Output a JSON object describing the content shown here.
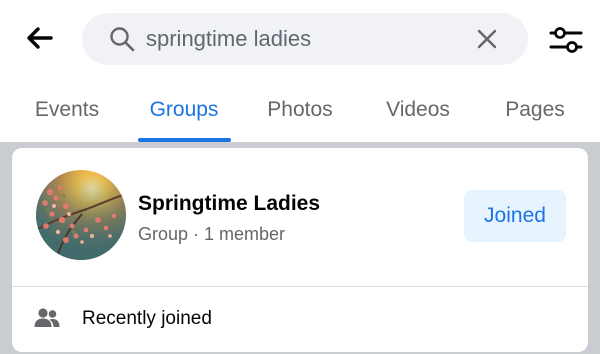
{
  "search": {
    "query": "springtime ladies",
    "back_icon": "arrow-left-icon",
    "search_icon": "search-icon",
    "clear_icon": "close-icon",
    "filter_icon": "filter-sliders-icon"
  },
  "tabs": [
    {
      "label": "Events",
      "active": false
    },
    {
      "label": "Groups",
      "active": true
    },
    {
      "label": "Photos",
      "active": false
    },
    {
      "label": "Videos",
      "active": false
    },
    {
      "label": "Pages",
      "active": false
    }
  ],
  "result": {
    "group_name": "Springtime Ladies",
    "group_meta": "Group · 1 member",
    "action_label": "Joined",
    "avatar": "blossom-photo"
  },
  "section": {
    "label": "Recently joined",
    "icon": "people-icon"
  },
  "colors": {
    "accent": "#1b74e4",
    "accent_bg": "#e7f3ff",
    "search_bg": "#f0f2f5",
    "secondary_text": "#65676b",
    "page_bg": "#c9ccd1"
  }
}
